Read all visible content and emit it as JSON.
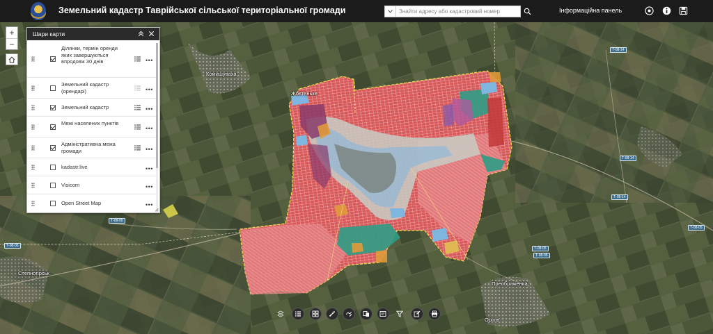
{
  "header": {
    "title": "Земельний кадастр Таврійської сільської територіальної громади",
    "search_placeholder": "Знайти адресу або кадастровий номер",
    "info_panel_label": "Інформаційна панель",
    "icons": [
      "logo-emblem",
      "search-icon",
      "eye-icon",
      "info-icon",
      "save-icon"
    ]
  },
  "map_controls": {
    "zoom_in": "+",
    "zoom_out": "−"
  },
  "layer_panel": {
    "title": "Шари карти",
    "layers": [
      {
        "label": "Ділянки, термін оренди яких завершуються впродовж 30 днів",
        "checked": true,
        "has_legend": true
      },
      {
        "label": "Земельний кадастр (орендарі)",
        "checked": false,
        "has_legend": true
      },
      {
        "label": "Земельний кадастр",
        "checked": true,
        "has_legend": true
      },
      {
        "label": "Межі населених пунктів",
        "checked": true,
        "has_legend": true
      },
      {
        "label": "Адміністративна межа громади",
        "checked": true,
        "has_legend": true
      },
      {
        "label": "kadastr.live",
        "checked": false,
        "has_legend": false
      },
      {
        "label": "Visicom",
        "checked": false,
        "has_legend": false
      },
      {
        "label": "Open Street Map",
        "checked": false,
        "has_legend": false
      }
    ],
    "more_glyph": "•••"
  },
  "map_labels": {
    "komyshuvakha": "Комишуваха",
    "zhovtenke": "Жовтеньке",
    "stepnohirsk": "Степногірськ",
    "preobrazhenka": "Преображенка",
    "orikhiv": "Оріхів"
  },
  "road_badges": [
    "Т-08-14",
    "Т-08-14",
    "Т-08-14",
    "Т-08-05",
    "Т-08-05",
    "Т-08-05",
    "Т-08-05",
    "Т-08-05"
  ],
  "colors": {
    "parcel_red": "#d9534f",
    "parcel_pink": "#f0a0a0",
    "boundary_yellow": "#f1e04a",
    "settlement_blue": "#7fb6e0",
    "teal": "#2f9c85",
    "header_bg": "#1b1b1b"
  },
  "toolbar_icons": [
    "layers-icon",
    "legend-icon",
    "grid-icon",
    "measure-icon",
    "draw-icon",
    "bookmark-icon",
    "basemap-icon",
    "filter-icon",
    "edit-icon",
    "print-icon"
  ]
}
